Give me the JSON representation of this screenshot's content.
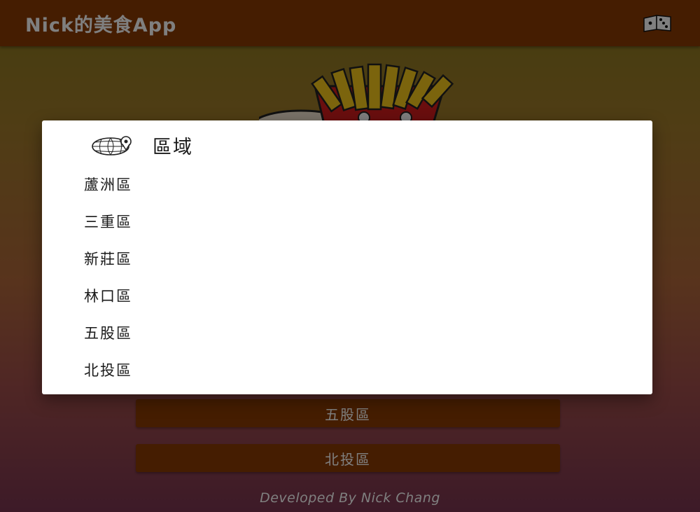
{
  "app": {
    "title": "Nick的美食App"
  },
  "header": {
    "dice_icon": "dice-icon"
  },
  "background": {
    "buttons": [
      {
        "label": "五股區"
      },
      {
        "label": "北投區"
      }
    ],
    "footer": "Developed By Nick Chang"
  },
  "dialog": {
    "icon": "globe-pin-icon",
    "title": "區域",
    "options": [
      {
        "label": "蘆洲區"
      },
      {
        "label": "三重區"
      },
      {
        "label": "新莊區"
      },
      {
        "label": "林口區"
      },
      {
        "label": "五股區"
      },
      {
        "label": "北投區"
      }
    ]
  },
  "colors": {
    "appbar": "#8b3a02",
    "button": "#8b3a02",
    "dialog_bg": "#ffffff",
    "text_dark": "#1a1a1a",
    "text_light": "#ffffff"
  }
}
